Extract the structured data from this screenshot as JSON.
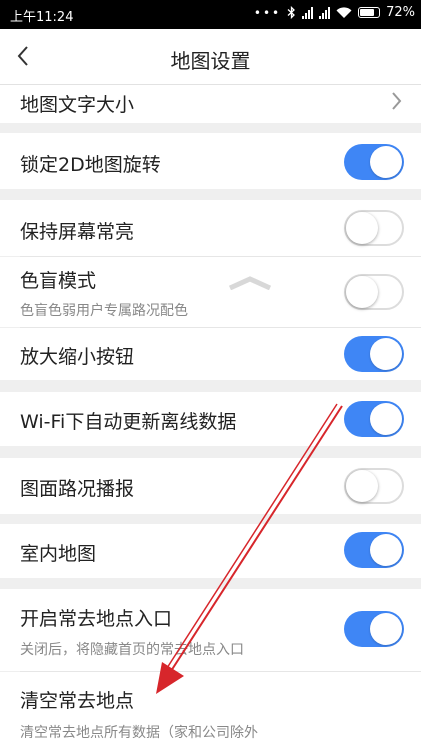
{
  "status_bar": {
    "time": "上午11:24",
    "battery": "72%"
  },
  "header": {
    "title": "地图设置"
  },
  "settings": [
    {
      "label": "地图文字大小"
    },
    {
      "label": "锁定2D地图旋转",
      "state": "on"
    },
    {
      "label": "保持屏幕常亮",
      "state": "off"
    },
    {
      "label": "色盲模式",
      "sub": "色盲色弱用户专属路况配色",
      "state": "off"
    },
    {
      "label": "放大缩小按钮",
      "state": "on"
    },
    {
      "label": "Wi-Fi下自动更新离线数据",
      "state": "on"
    },
    {
      "label": "图面路况播报",
      "state": "off"
    },
    {
      "label": "室内地图",
      "state": "on"
    },
    {
      "label": "开启常去地点入口",
      "sub": "关闭后，将隐藏首页的常去地点入口",
      "state": "on"
    },
    {
      "label": "清空常去地点",
      "sub": "清空常去地点所有数据（家和公司除外"
    }
  ],
  "colors": {
    "toggle_on": "#3f86f5",
    "annotation_arrow": "#d7262b"
  }
}
